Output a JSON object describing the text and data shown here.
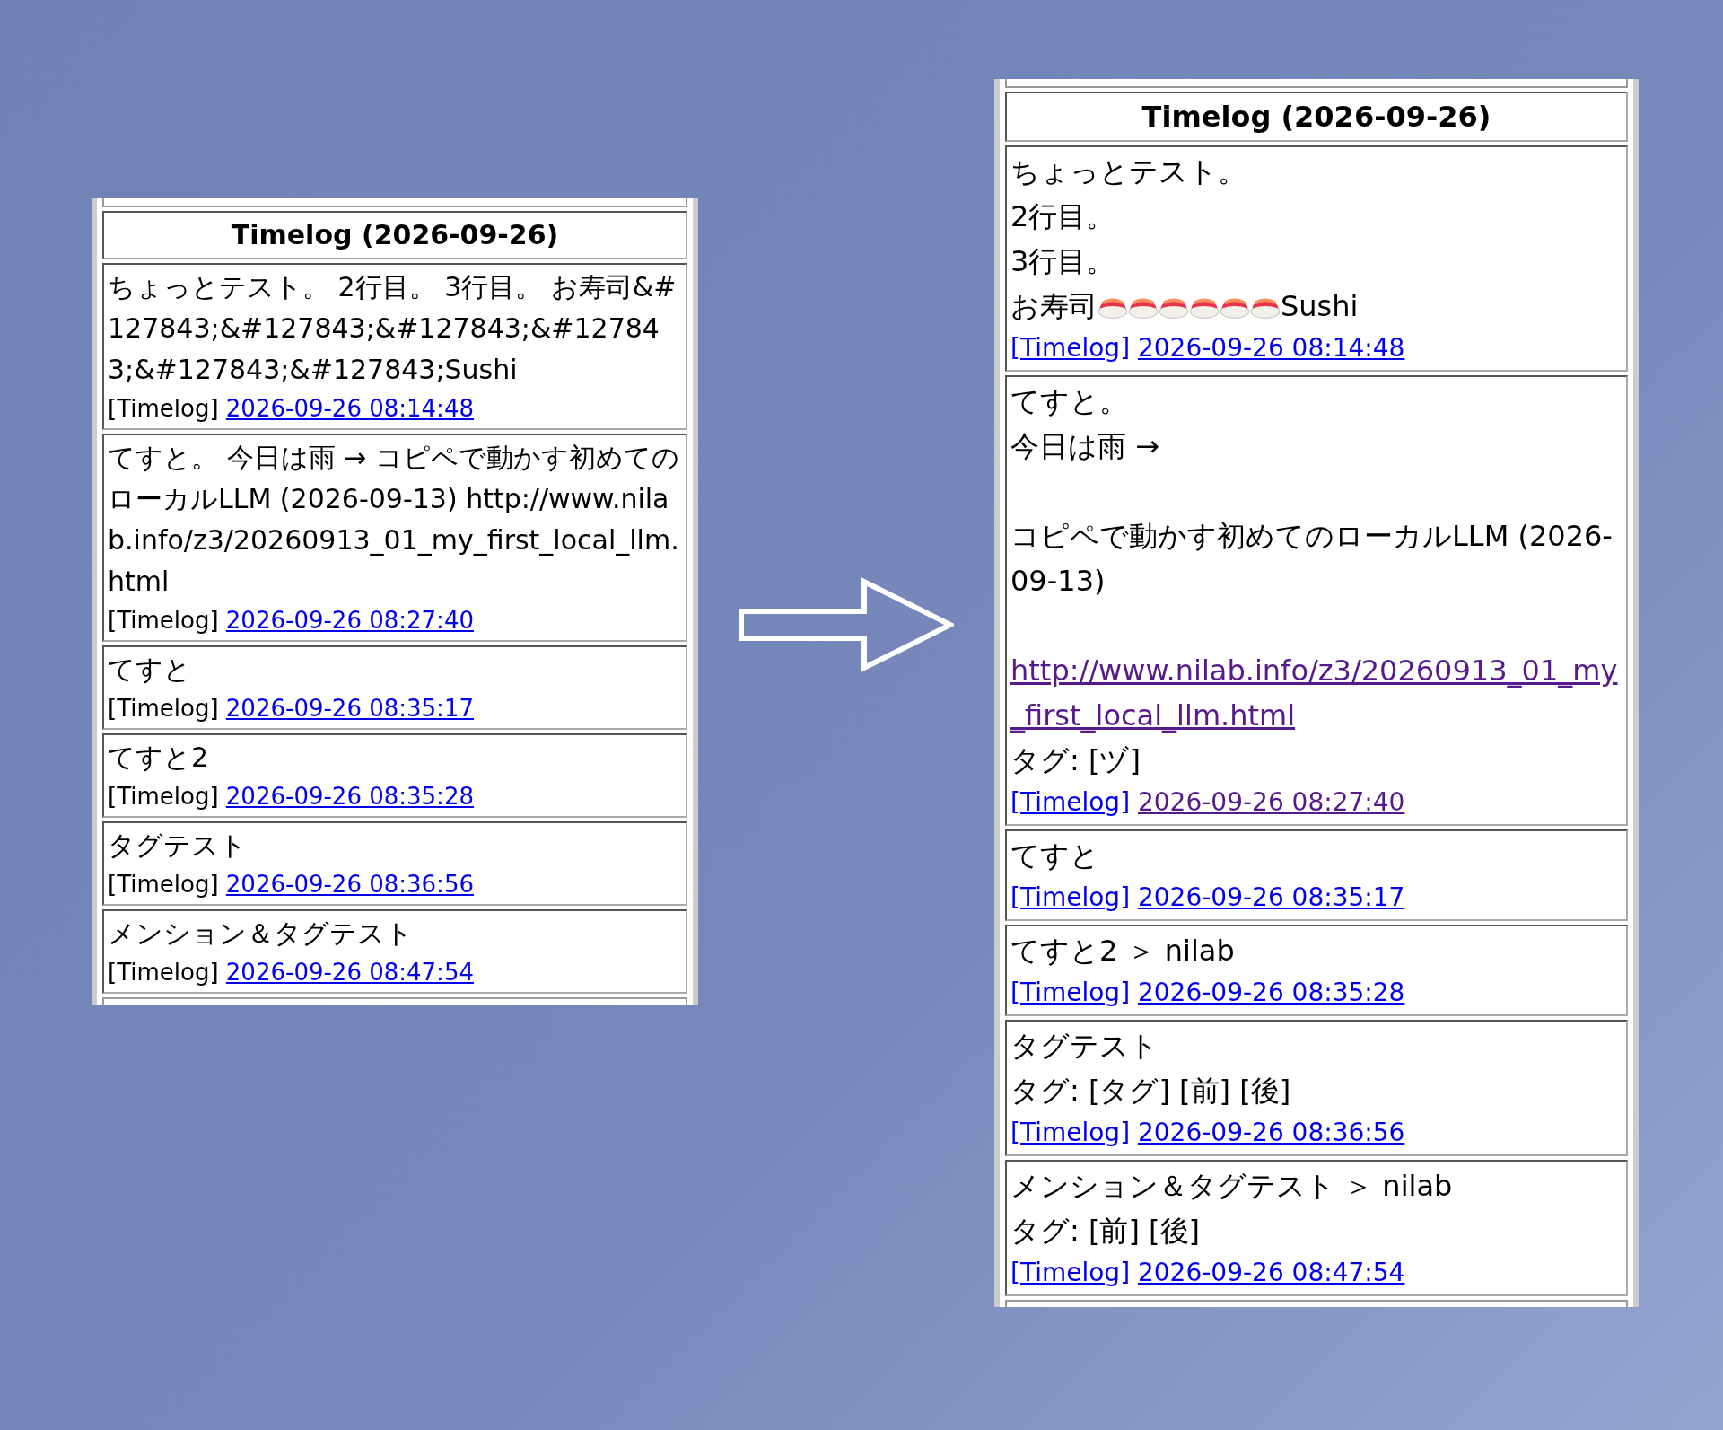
{
  "panels": [
    {
      "kind": "before",
      "heading": "Timelog (2026-09-26)",
      "entries": [
        {
          "lines": [
            {
              "kind": "text",
              "text": "ちょっとテスト。 2行目。 3行目。 お寿司&#127843;&#127843;&#127843;&#127843;&#127843;&#127843;Sushi"
            }
          ],
          "source": {
            "text": "[Timelog]",
            "link": false
          },
          "date": {
            "text": "2026-09-26 08:14:48",
            "visited": false
          }
        },
        {
          "lines": [
            {
              "kind": "text",
              "text": "てすと。 今日は雨 → コピペで動かす初めてのローカルLLM (2026-09-13) http://www.nilab.info/z3/20260913_01_my_first_local_llm.html"
            }
          ],
          "source": {
            "text": "[Timelog]",
            "link": false
          },
          "date": {
            "text": "2026-09-26 08:27:40",
            "visited": false
          }
        },
        {
          "lines": [
            {
              "kind": "text",
              "text": "てすと"
            }
          ],
          "source": {
            "text": "[Timelog]",
            "link": false
          },
          "date": {
            "text": "2026-09-26 08:35:17",
            "visited": false
          }
        },
        {
          "lines": [
            {
              "kind": "text",
              "text": "てすと2"
            }
          ],
          "source": {
            "text": "[Timelog]",
            "link": false
          },
          "date": {
            "text": "2026-09-26 08:35:28",
            "visited": false
          }
        },
        {
          "lines": [
            {
              "kind": "text",
              "text": "タグテスト"
            }
          ],
          "source": {
            "text": "[Timelog]",
            "link": false
          },
          "date": {
            "text": "2026-09-26 08:36:56",
            "visited": false
          }
        },
        {
          "lines": [
            {
              "kind": "text",
              "text": "メンション＆タグテスト"
            }
          ],
          "source": {
            "text": "[Timelog]",
            "link": false
          },
          "date": {
            "text": "2026-09-26 08:47:54",
            "visited": false
          }
        }
      ]
    },
    {
      "kind": "after",
      "heading": "Timelog (2026-09-26)",
      "entries": [
        {
          "lines": [
            {
              "kind": "text",
              "text": "ちょっとテスト。"
            },
            {
              "kind": "text",
              "text": "2行目。"
            },
            {
              "kind": "text",
              "text": "3行目。"
            },
            {
              "kind": "parts",
              "parts": [
                {
                  "kind": "text",
                  "text": "お寿司"
                },
                {
                  "kind": "sushi"
                },
                {
                  "kind": "sushi"
                },
                {
                  "kind": "sushi"
                },
                {
                  "kind": "sushi"
                },
                {
                  "kind": "sushi"
                },
                {
                  "kind": "sushi"
                },
                {
                  "kind": "text",
                  "text": "Sushi"
                }
              ]
            }
          ],
          "source": {
            "text": "[Timelog]",
            "link": true
          },
          "date": {
            "text": "2026-09-26 08:14:48",
            "visited": false
          }
        },
        {
          "lines": [
            {
              "kind": "text",
              "text": "てすと。"
            },
            {
              "kind": "text",
              "text": "今日は雨 →"
            },
            {
              "kind": "blank"
            },
            {
              "kind": "text",
              "text": "コピペで動かす初めてのローカルLLM (2026-09-13)"
            },
            {
              "kind": "blank"
            },
            {
              "kind": "link",
              "text": "http://www.nilab.info/z3/20260913_01_my_first_local_llm.html",
              "visited": true
            },
            {
              "kind": "text",
              "text": "タグ: [ヅ]"
            }
          ],
          "source": {
            "text": "[Timelog]",
            "link": true
          },
          "date": {
            "text": "2026-09-26 08:27:40",
            "visited": true
          }
        },
        {
          "lines": [
            {
              "kind": "text",
              "text": "てすと"
            }
          ],
          "source": {
            "text": "[Timelog]",
            "link": true
          },
          "date": {
            "text": "2026-09-26 08:35:17",
            "visited": false
          }
        },
        {
          "lines": [
            {
              "kind": "text",
              "text": "てすと2 ＞ nilab"
            }
          ],
          "source": {
            "text": "[Timelog]",
            "link": true
          },
          "date": {
            "text": "2026-09-26 08:35:28",
            "visited": false
          }
        },
        {
          "lines": [
            {
              "kind": "text",
              "text": "タグテスト"
            },
            {
              "kind": "text",
              "text": "タグ: [タグ] [前] [後]"
            }
          ],
          "source": {
            "text": "[Timelog]",
            "link": true
          },
          "date": {
            "text": "2026-09-26 08:36:56",
            "visited": false
          }
        },
        {
          "lines": [
            {
              "kind": "text",
              "text": "メンション＆タグテスト ＞ nilab"
            },
            {
              "kind": "text",
              "text": "タグ: [前] [後]"
            }
          ],
          "source": {
            "text": "[Timelog]",
            "link": true
          },
          "date": {
            "text": "2026-09-26 08:47:54",
            "visited": false
          }
        }
      ]
    }
  ]
}
